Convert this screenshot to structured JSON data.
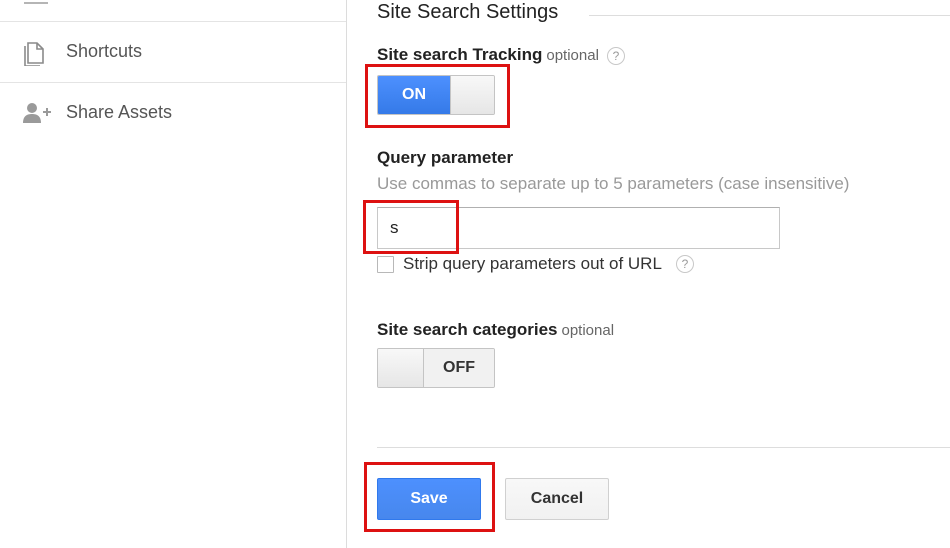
{
  "sidebar": {
    "items": [
      {
        "label": "Shortcuts",
        "icon": "document-icon"
      },
      {
        "label": "Share Assets",
        "icon": "add-person-icon"
      }
    ]
  },
  "settings": {
    "section_title": "Site Search Settings",
    "tracking": {
      "label": "Site search Tracking",
      "optional": "optional",
      "help": "?",
      "toggle_state": "ON"
    },
    "query_parameter": {
      "label": "Query parameter",
      "hint": "Use commas to separate up to 5 parameters (case insensitive)",
      "value": "s"
    },
    "strip": {
      "label": "Strip query parameters out of URL",
      "checked": false,
      "help": "?"
    },
    "categories": {
      "label": "Site search categories",
      "optional": "optional",
      "toggle_state": "OFF"
    }
  },
  "actions": {
    "save_label": "Save",
    "cancel_label": "Cancel"
  },
  "colors": {
    "accent_blue": "#4d90fe",
    "highlight_red": "#dd1111"
  }
}
